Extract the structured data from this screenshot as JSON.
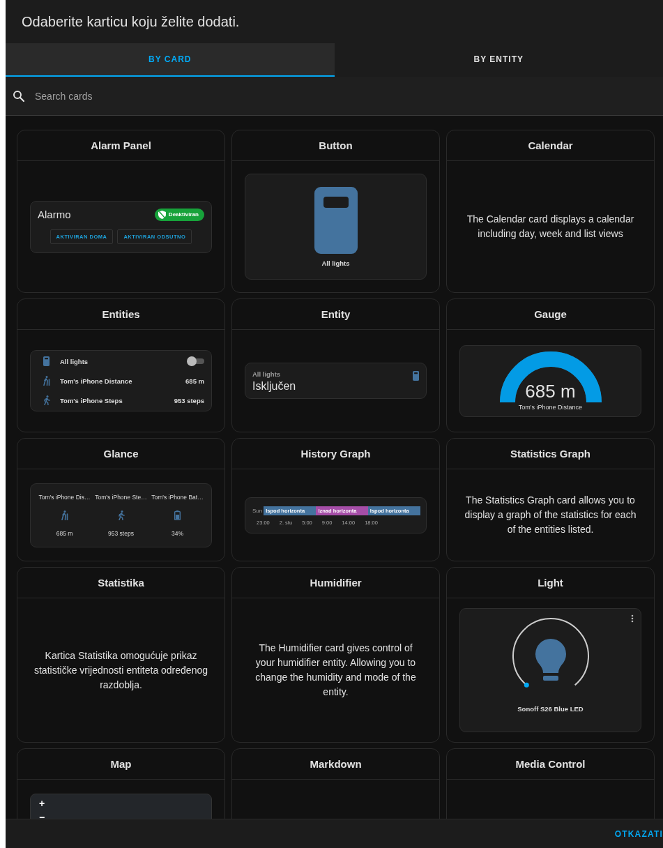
{
  "dialog": {
    "title": "Odaberite karticu koju želite dodati."
  },
  "tabs": [
    {
      "label": "BY CARD",
      "selected": true
    },
    {
      "label": "BY ENTITY",
      "selected": false
    }
  ],
  "search": {
    "placeholder": "Search cards"
  },
  "cards": [
    {
      "title": "Alarm Panel",
      "kind": "alarm",
      "name": "Alarmo",
      "state": "Deaktiviran",
      "actions": [
        "AKTIVIRAN DOMA",
        "AKTIVIRAN ODSUTNO"
      ]
    },
    {
      "title": "Button",
      "kind": "button",
      "name": "All lights"
    },
    {
      "title": "Calendar",
      "kind": "description",
      "text": "The Calendar card displays a calendar including day, week and list views"
    },
    {
      "title": "Entities",
      "kind": "entities",
      "rows": [
        {
          "kind": "toggle",
          "name": "All lights",
          "on": false
        },
        {
          "kind": "value",
          "name": "Tom's iPhone Distance",
          "value": "685 m"
        },
        {
          "kind": "value",
          "name": "Tom's iPhone Steps",
          "value": "953 steps"
        }
      ]
    },
    {
      "title": "Entity",
      "kind": "entity",
      "name": "All lights",
      "state": "Isključen"
    },
    {
      "title": "Gauge",
      "kind": "gauge",
      "value": "685 m",
      "name": "Tom's iPhone Distance",
      "level": 1
    },
    {
      "title": "Glance",
      "kind": "glance",
      "items": [
        {
          "name": "Tom's iPhone Dis…",
          "value": "685 m"
        },
        {
          "name": "Tom's iPhone Ste…",
          "value": "953 steps"
        },
        {
          "name": "Tom's iPhone Bat…",
          "value": "34%"
        }
      ]
    },
    {
      "title": "History Graph",
      "kind": "history",
      "row_label": "Sun",
      "segments": [
        {
          "label": "Ispod horizonta",
          "color": "#44739e"
        },
        {
          "label": "Iznad horizonta",
          "color": "#a64ea8"
        },
        {
          "label": "Ispod horizonta",
          "color": "#44739e"
        }
      ],
      "ticks": [
        "23:00",
        "2. stu",
        "5:00",
        "9:00",
        "14:00",
        "18:00"
      ]
    },
    {
      "title": "Statistics Graph",
      "kind": "description",
      "text": "The Statistics Graph card allows you to display a graph of the statistics for each of the entities listed."
    },
    {
      "title": "Statistika",
      "kind": "description",
      "text": "Kartica Statistika omogućuje prikaz statističke vrijednosti entiteta određenog razdoblja."
    },
    {
      "title": "Humidifier",
      "kind": "description",
      "text": "The Humidifier card gives control of your humidifier entity. Allowing you to change the humidity and mode of the entity."
    },
    {
      "title": "Light",
      "kind": "light",
      "name": "Sonoff S26 Blue LED"
    },
    {
      "title": "Map",
      "kind": "map",
      "zoom_in": "+",
      "zoom_out": "−"
    },
    {
      "title": "Markdown",
      "kind": "empty"
    },
    {
      "title": "Media Control",
      "kind": "empty"
    }
  ],
  "footer": {
    "cancel": "OTKAZATI"
  }
}
